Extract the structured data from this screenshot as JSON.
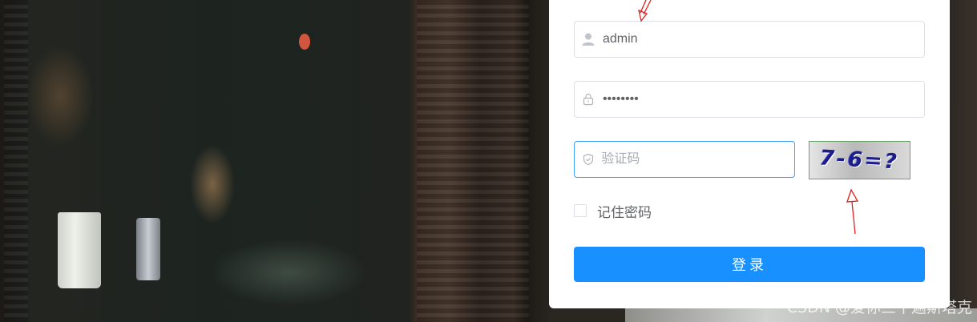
{
  "form": {
    "username": {
      "value": "admin",
      "icon": "user-icon"
    },
    "password": {
      "value": "password",
      "icon": "lock-icon"
    },
    "captcha_input": {
      "placeholder": "验证码",
      "value": "",
      "icon": "shield-icon"
    },
    "captcha_image": {
      "text": "7-6=?"
    },
    "remember": {
      "label": "记住密码",
      "checked": false
    },
    "login_button": {
      "label": "登录"
    }
  },
  "watermark": "CSDN @爱你三千遍斯塔克",
  "colors": {
    "primary": "#1890ff",
    "focus_border": "#409eff",
    "annotation_arrow": "#e02020"
  }
}
